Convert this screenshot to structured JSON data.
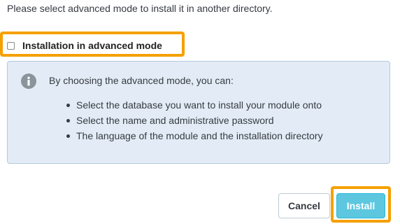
{
  "intro_text": "Please select advanced mode to install it in another directory.",
  "advanced_mode": {
    "label": "Installation in advanced mode",
    "checked": false
  },
  "info": {
    "icon": "info-icon",
    "lead": "By choosing the advanced mode, you can:",
    "items": [
      "Select the database you want to install your module onto",
      "Select the name and administrative password",
      "The language of the module and the installation directory"
    ]
  },
  "buttons": {
    "cancel_label": "Cancel",
    "install_label": "Install"
  },
  "colors": {
    "highlight": "#f5a000",
    "info_background": "#e3ecf6",
    "info_border": "#b3c8dc",
    "install_button": "#5dc7e0",
    "text": "#363a41"
  }
}
